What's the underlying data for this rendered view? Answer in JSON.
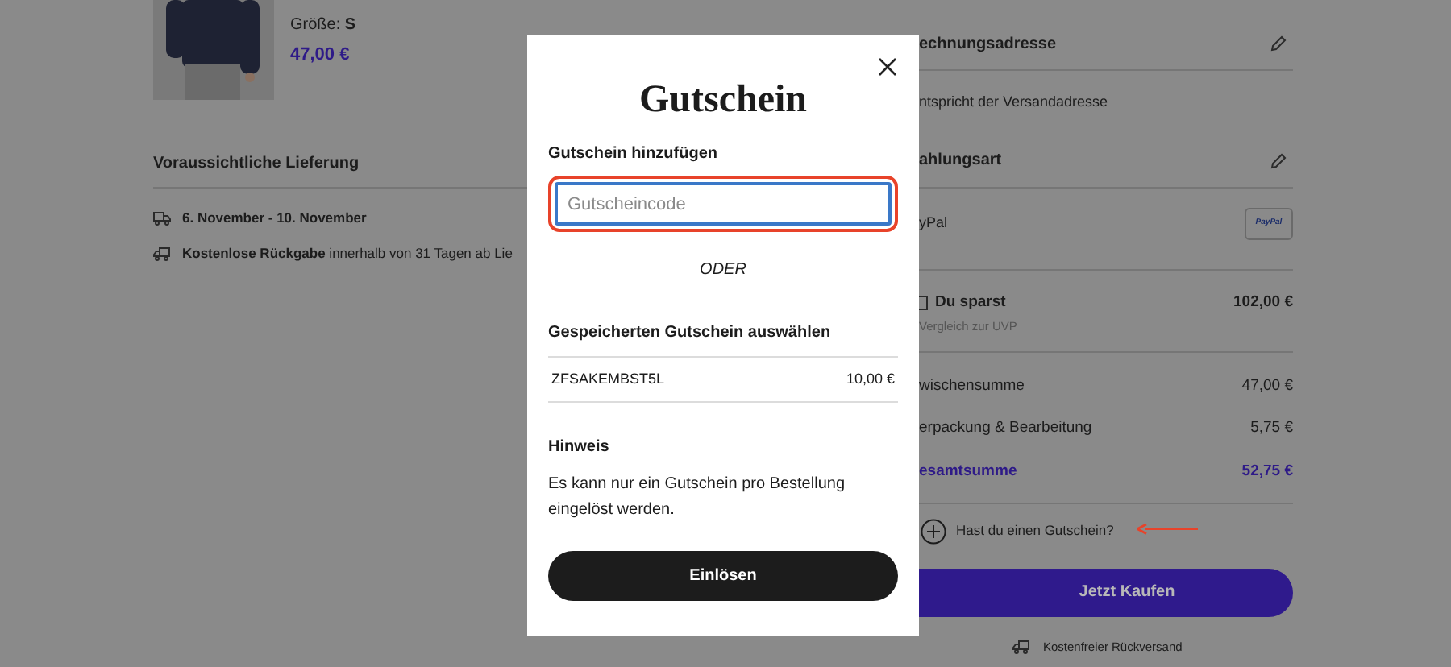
{
  "product": {
    "size_label": "Größe: ",
    "size_value": "S",
    "price": "47,00 €"
  },
  "delivery": {
    "title": "Voraussichtliche Lieferung",
    "items": [
      {
        "kind": "truck",
        "text": "**6. November - 10. November**"
      },
      {
        "kind": "return",
        "text": "**Kostenlose Rückgabe** innerhalb von 31 Tagen ab Lie"
      }
    ]
  },
  "modal": {
    "title": "Gutschein",
    "add_label": "Gutschein hinzufügen",
    "input": {
      "placeholder": "Gutscheincode",
      "highlighted": true
    },
    "or": "ODER",
    "saved_title": "Gespeicherten Gutschein auswählen",
    "saved": [
      {
        "code": "ZFSAKEMBST5L",
        "amount": "10,00 €"
      }
    ],
    "note_title": "Hinweis",
    "note": "Es kann nur ein Gutschein pro Bestellung eingelöst werden.",
    "button": "Einlösen"
  },
  "summary": {
    "billing_title": "echnungsadresse",
    "billing_text": "ntspricht der Versandadresse",
    "payment_title": "ahlungsart",
    "payment_method": "yPal",
    "payment_badge": "PayPal",
    "savings": {
      "label": "Du sparst",
      "value": "102,00 €",
      "note": "Vergleich zur UVP"
    },
    "lines": [
      {
        "label": "wischensumme",
        "value": "47,00 €",
        "total": false
      },
      {
        "label": "erpackung & Bearbeitung",
        "value": "5,75 €",
        "total": false
      },
      {
        "label": "esamtsumme",
        "value": "52,75 €",
        "total": true
      }
    ],
    "voucher_link": "Hast du einen Gutschein?",
    "voucher_arrow": true,
    "buy_button": "Jetzt Kaufen",
    "return_note": "Kostenfreier Rückversand"
  }
}
